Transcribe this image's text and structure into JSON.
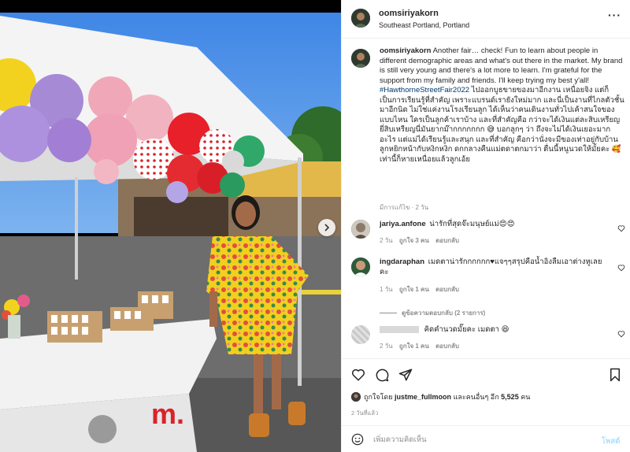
{
  "post": {
    "username": "oomsiriyakorn",
    "location": "Southeast Portland, Portland",
    "more_label": "···"
  },
  "caption": {
    "username": "oomsiriyakorn",
    "text": "Another fair… check! Fun to learn about people in different demographic areas and what's out there in the market. My brand is still very young and there's a lot more to learn. I'm grateful for the support from my family and friends. I'll keep trying my best y'all! ",
    "hashtag": "#HawthorneStreetFair2022",
    "text_thai": " ไปออกบูธขายของมาอีกงาน เหนื่อยจิง แต่ก็เป็นการเรียนรู้ที่สำคัญ เพราะแบรนด์เรายังใหม่มาก และนี่เป็นงานที่ไกลตัวชั้นมาอีกนิด ไม่ใช่แค่งานโรงเรียนลูก ได้เห็นว่าคนเดินงานทั่วไปเค้าสนใจของแบบไหน ใครเป็นลูกค้าเราบ้าง และที่สำคัญคือ กว่าจะได้เงินแต่ละสิบเหรียญยี่สิบเหรียญนี่มันยากม๊ากกกกกกก 😅 บอกลูกๆ ว่า ถึงจะไม่ได้เงินเยอะมากอะไร แต่แม่ได้เรียนรู้และสนุก และที่สำคัญ คือกว่านั่งจะมีของเท่าอยู่กับบ้าน ลูกหยิกหน้ากับหงิกหงิก ดกกลางคืนแม่ตดาตกมาว่า ตื่นนี้หนูนวดให้มั้ยคะ 🥰 เท่านี้ก็หายเหนื่อยแล้วลูกเอ้ย",
    "meta": "มีการแก้ไข · 2 วัน"
  },
  "comments": [
    {
      "username": "jariya.anfone",
      "text": "น่ารักที่สุดจ๊ะมนุษย์แม่😍😍",
      "time": "2 วัน",
      "likes": "ถูกใจ 3 คน",
      "reply": "ตอบกลับ"
    },
    {
      "username": "ingdaraphan",
      "text": "เมดตาน่ารักกกกกก♥แจๆๆสรุปคือน้ำอิงลืมเอาต่างหูเลยคะ",
      "time": "1 วัน",
      "likes": "ถูกใจ 1 คน",
      "reply": "ตอบกลับ"
    },
    {
      "username": "",
      "text": "คิดคำนวดมั๊ยคะ เมดตา 😆",
      "time": "2 วัน",
      "likes": "ถูกใจ 1 คน",
      "reply": "ตอบกลับ"
    }
  ],
  "view_replies": "ดูข้อความตอบกลับ (2 รายการ)",
  "likes": {
    "prefix": "ถูกใจโดย",
    "user": "justme_fullmoon",
    "middle": "และคนอื่นๆ อีก",
    "count": "5,525",
    "suffix": "คน"
  },
  "timestamp": "2 วันที่แล้ว",
  "add_comment": {
    "placeholder": "เพิ่มความคิดเห็น",
    "post_label": "โพสต์"
  },
  "icons": {
    "like": "heart-icon",
    "comment": "comment-icon",
    "share": "share-icon",
    "save": "bookmark-icon",
    "emoji": "emoji-icon",
    "next": "chevron-right-icon"
  },
  "colors": {
    "hashtag": "#00376b",
    "muted": "#8e8e8e",
    "post_button": "#b2dffc",
    "divider": "#efefef"
  }
}
